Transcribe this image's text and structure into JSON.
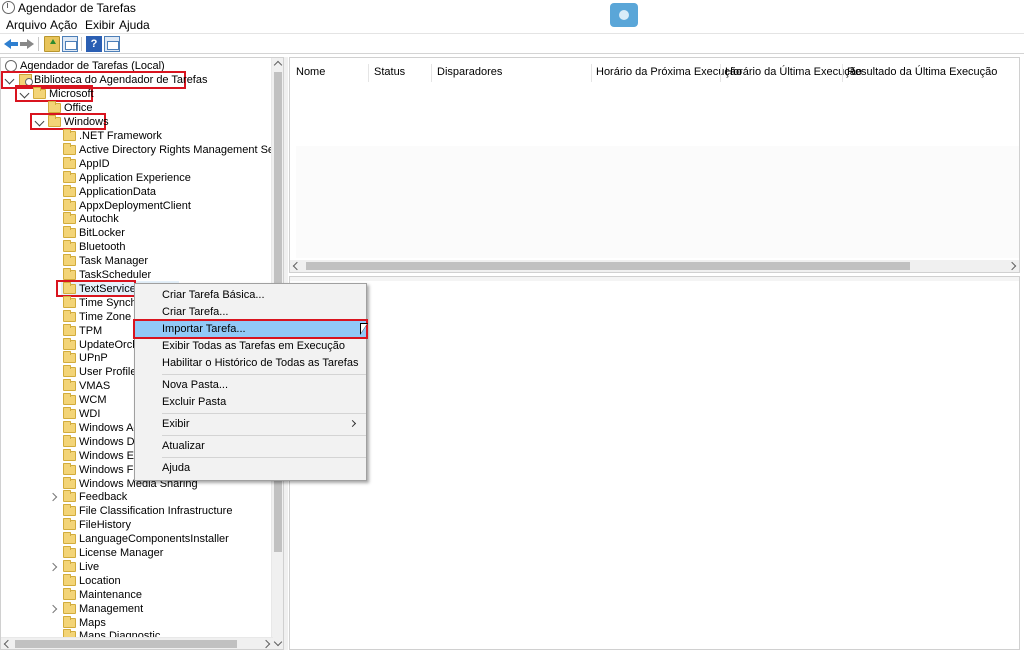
{
  "window": {
    "title": "Agendador de Tarefas"
  },
  "menubar": {
    "items": [
      "Arquivo",
      "Ação",
      "Exibir",
      "Ajuda"
    ]
  },
  "toolbar": {
    "buttons": [
      "back-arrow-icon",
      "forward-arrow-icon",
      "folder-up-icon",
      "show-hide-console-tree-icon",
      "help-icon",
      "action-pane-icon"
    ]
  },
  "tree": {
    "root": "Agendador de Tarefas (Local)",
    "library": "Biblioteca do Agendador de Tarefas",
    "microsoft": "Microsoft",
    "office": "Office",
    "windows": "Windows",
    "windows_children": [
      ".NET Framework",
      "Active Directory Rights Management Services C",
      "AppID",
      "Application Experience",
      "ApplicationData",
      "AppxDeploymentClient",
      "Autochk",
      "BitLocker",
      "Bluetooth",
      "Task Manager",
      "TaskScheduler",
      "TextServicesFr",
      "Time Synchro",
      "Time Zone",
      "TPM",
      "UpdateOrches",
      "UPnP",
      "User Profile Se",
      "VMAS",
      "WCM",
      "WDI",
      "Windows Acti",
      "Windows Defe",
      "Windows Erro",
      "Windows Filte",
      "Windows Media Sharing",
      "Feedback",
      "File Classification Infrastructure",
      "FileHistory",
      "LanguageComponentsInstaller",
      "License Manager",
      "Live",
      "Location",
      "Maintenance",
      "Management",
      "Maps",
      "Maps Diagnostic"
    ],
    "expandable": [
      "Feedback",
      "Live",
      "Management"
    ]
  },
  "list": {
    "columns": [
      "Nome",
      "Status",
      "Disparadores",
      "Horário da Próxima Execução",
      "Horário da Última Execução",
      "Resultado da Última Execução"
    ]
  },
  "context_menu": {
    "items": [
      "Criar Tarefa Básica...",
      "Criar Tarefa...",
      "Importar Tarefa...",
      "Exibir Todas as Tarefas em Execução",
      "Habilitar o Histórico de Todas as Tarefas",
      "Nova Pasta...",
      "Excluir Pasta",
      "Exibir",
      "Atualizar",
      "Ajuda"
    ],
    "highlighted": "Importar Tarefa..."
  },
  "colors": {
    "highlight_border": "#d9141f",
    "menu_hover": "#91c9f7"
  }
}
